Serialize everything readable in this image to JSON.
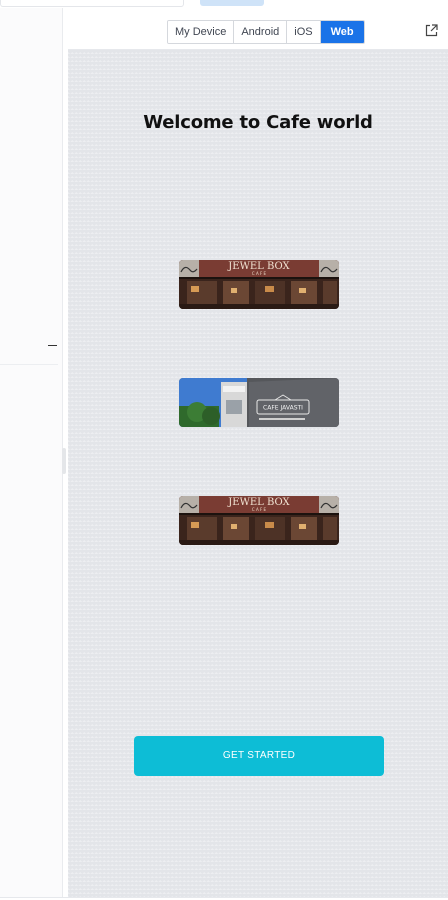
{
  "toolbar": {
    "device_tabs": [
      {
        "label": "My Device",
        "active": false
      },
      {
        "label": "Android",
        "active": false
      },
      {
        "label": "iOS",
        "active": false
      },
      {
        "label": "Web",
        "active": true
      }
    ],
    "open_external_icon": "external-link-icon"
  },
  "app": {
    "title": "Welcome to Cafe world",
    "images": [
      {
        "name": "Jewel Box Cafe",
        "sign": "JEWEL BOX",
        "sub": "C A F E"
      },
      {
        "name": "Cafe Javasti",
        "sign": "CAFE JAVASTI"
      },
      {
        "name": "Jewel Box Cafe",
        "sign": "JEWEL BOX",
        "sub": "C A F E"
      }
    ],
    "cta_label": "GET STARTED"
  },
  "colors": {
    "accent": "#1a73e8",
    "cta": "#0dbdd6",
    "preview_bg": "#e3e5e9"
  }
}
